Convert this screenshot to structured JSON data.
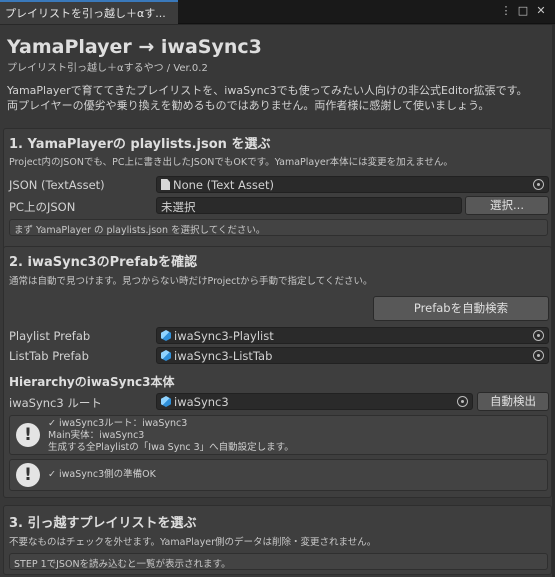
{
  "window": {
    "tab_title": "プレイリストを引っ越し＋αす...",
    "menu_glyph": "⋮",
    "max_glyph": "□",
    "close_glyph": "✕"
  },
  "header": {
    "title": "YamaPlayer → iwaSync3",
    "subtitle": "プレイリスト引っ越し＋αするやつ  /  Ver.0.2",
    "desc_line1": "YamaPlayerで育ててきたプレイリストを、iwaSync3でも使ってみたい人向けの非公式Editor拡張です。",
    "desc_line2": "両プレイヤーの優劣や乗り換えを勧めるものではありません。両作者様に感謝して使いましょう。"
  },
  "step1": {
    "title": "1. YamaPlayerの playlists.json を選ぶ",
    "note": "Project内のJSONでも、PC上に書き出したJSONでもOKです。YamaPlayer本体には変更を加えません。",
    "json_label": "JSON (TextAsset)",
    "json_value": "None (Text Asset)",
    "pc_label": "PC上のJSON",
    "pc_value": "未選択",
    "select_button": "選択...",
    "hint": "まず YamaPlayer の playlists.json を選択してください。"
  },
  "step2": {
    "title": "2. iwaSync3のPrefabを確認",
    "note": "通常は自動で見つけます。見つからない時だけProjectから手動で指定してください。",
    "auto_search_button": "Prefabを自動検索",
    "playlist_label": "Playlist Prefab",
    "playlist_value": "iwaSync3-Playlist",
    "listtab_label": "ListTab Prefab",
    "listtab_value": "iwaSync3-ListTab",
    "hierarchy_title": "HierarchyのiwaSync3本体",
    "root_label": "iwaSync3 ルート",
    "root_value": "iwaSync3",
    "auto_detect_button": "自動検出",
    "info1_line1": "✓ iwaSync3ルート：iwaSync3",
    "info1_line2": "Main実体：iwaSync3",
    "info1_line3": "生成する全Playlistの「Iwa Sync 3」へ自動設定します。",
    "info2_line1": "✓ iwaSync3側の準備OK"
  },
  "step3": {
    "title": "3. 引っ越すプレイリストを選ぶ",
    "note": "不要なものはチェックを外せます。YamaPlayer側のデータは削除・変更されません。",
    "hint": "STEP 1でJSONを読み込むと一覧が表示されます。"
  }
}
